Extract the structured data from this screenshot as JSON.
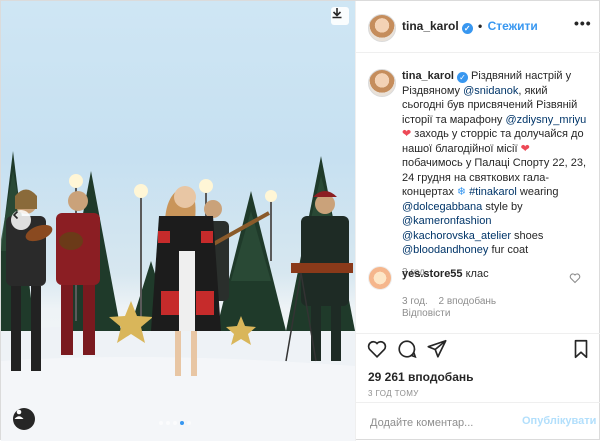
{
  "post": {
    "photo_alt": "",
    "download_icon": "download-icon",
    "carousel_dots": 5,
    "carousel_active": 4
  },
  "header": {
    "username": "tina_karol",
    "separator": "•",
    "follow_label": "Стежити",
    "more_label": "•••"
  },
  "caption": {
    "username": "tina_karol",
    "parts": {
      "p1": "Різдвяний настрій у Різдвяному ",
      "mention1": "@snidanok",
      "p2": ", який сьогодні був присвячений Різвяній історії та марафону ",
      "mention2": "@zdiysny_mriyu",
      "p3": " заходь у сторріс та долучайся до нашої благодійної місії ",
      "p4": " побачимось у Палаці Спорту 22, 23, 24 грудня на святкових гала-концертах ",
      "hashtag": "#tinakarol",
      "p5": " wearing ",
      "mention3": "@dolcegabbana",
      "p6": " style by ",
      "mention4": "@kameronfashion",
      "mention5": "@kachorovska_atelier",
      "p7": " shoes ",
      "mention6": "@bloodandhoney",
      "p8": " fur coat"
    },
    "time": "3 год."
  },
  "comment": {
    "username": "yes.store55",
    "text": "клас",
    "time": "3 год.",
    "likes": "2 вподобань",
    "reply_label": "Відповісти"
  },
  "actions": {
    "likes_count": "29 261 вподобань",
    "time_ago": "3 ГОД ТОМУ",
    "comment_placeholder": "Додайте коментар...",
    "post_label": "Опублікувати"
  },
  "colors": {
    "accent": "#3897f0",
    "heart": "#ed4956",
    "muted": "#8e8e8e",
    "link": "#003569"
  }
}
